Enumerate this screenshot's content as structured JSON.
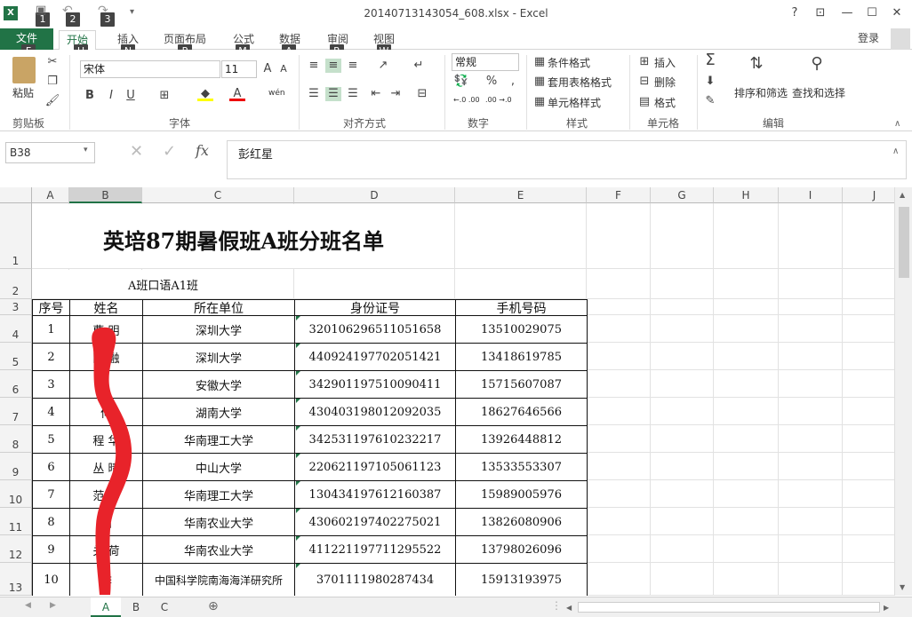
{
  "window": {
    "title": "20140713143054_608.xlsx - Excel",
    "help": "?",
    "login": "登录"
  },
  "qat": {
    "keytips": [
      "1",
      "2",
      "3"
    ]
  },
  "tabs": [
    {
      "label": "文件",
      "key": "F"
    },
    {
      "label": "开始",
      "key": "H"
    },
    {
      "label": "插入",
      "key": "N"
    },
    {
      "label": "页面布局",
      "key": "P"
    },
    {
      "label": "公式",
      "key": "M"
    },
    {
      "label": "数据",
      "key": "A"
    },
    {
      "label": "审阅",
      "key": "R"
    },
    {
      "label": "视图",
      "key": "W"
    }
  ],
  "ribbon": {
    "clipboard": {
      "paste": "粘贴",
      "label": "剪贴板"
    },
    "font": {
      "name": "宋体",
      "size": "11",
      "label": "字体",
      "bold": "B",
      "italic": "I",
      "underline": "U",
      "phonetic": "wén"
    },
    "alignment": {
      "label": "对齐方式"
    },
    "number": {
      "format": "常规",
      "label": "数字",
      "percent": "%",
      "comma": ",",
      "inc": "←.0 .00",
      "dec": ".00 →.0"
    },
    "styles": {
      "conditional": "条件格式",
      "table": "套用表格格式",
      "cell": "单元格样式",
      "label": "样式"
    },
    "cells": {
      "insert": "插入",
      "delete": "删除",
      "format": "格式",
      "label": "单元格"
    },
    "editing": {
      "sort": "排序和筛选",
      "find": "查找和选择",
      "label": "编辑",
      "sigma": "Σ"
    }
  },
  "formula": {
    "namebox": "B38",
    "value": "彭红星",
    "fx": "fx"
  },
  "columns": [
    "A",
    "B",
    "C",
    "D",
    "E",
    "F",
    "G",
    "H",
    "I",
    "J"
  ],
  "sheet": {
    "title": "英培87期暑假班A班分班名单",
    "subtitle": "A班口语A1班",
    "headers": [
      "序号",
      "姓名",
      "所在单位",
      "身份证号",
      "手机号码"
    ],
    "rows": [
      [
        "1",
        "曹 明",
        "深圳大学",
        "320106296511051658",
        "13510029075"
      ],
      [
        "2",
        "陈 融",
        "深圳大学",
        "440924197702051421",
        "13418619785"
      ],
      [
        "3",
        "",
        "安徽大学",
        "342901197510090411",
        "15715607087"
      ],
      [
        "4",
        "何 ",
        "湖南大学",
        "430403198012092035",
        "18627646566"
      ],
      [
        "5",
        "程 华",
        "华南理工大学",
        "342531197610232217",
        "13926448812"
      ],
      [
        "6",
        "丛 晴",
        "中山大学",
        "220621197105061123",
        "13533553307"
      ],
      [
        "7",
        "范 华",
        "华南理工大学",
        "130434197612160387",
        "15989005976"
      ],
      [
        "8",
        "高 ",
        "华南农业大学",
        "430602197402275021",
        "13826080906"
      ],
      [
        "9",
        "关 荷",
        "华南农业大学",
        "411221197711295522",
        "13798026096"
      ],
      [
        "10",
        "李 ",
        "中国科学院南海海洋研究所",
        "3701111980287434",
        "15913193975"
      ]
    ],
    "row_numbers": [
      "1",
      "2",
      "3",
      "4",
      "5",
      "6",
      "7",
      "8",
      "9",
      "10",
      "11",
      "12",
      "13"
    ]
  },
  "sheet_tabs": [
    "A",
    "B",
    "C"
  ],
  "colors": {
    "excel_green": "#217346",
    "redaction": "#e8232a"
  }
}
